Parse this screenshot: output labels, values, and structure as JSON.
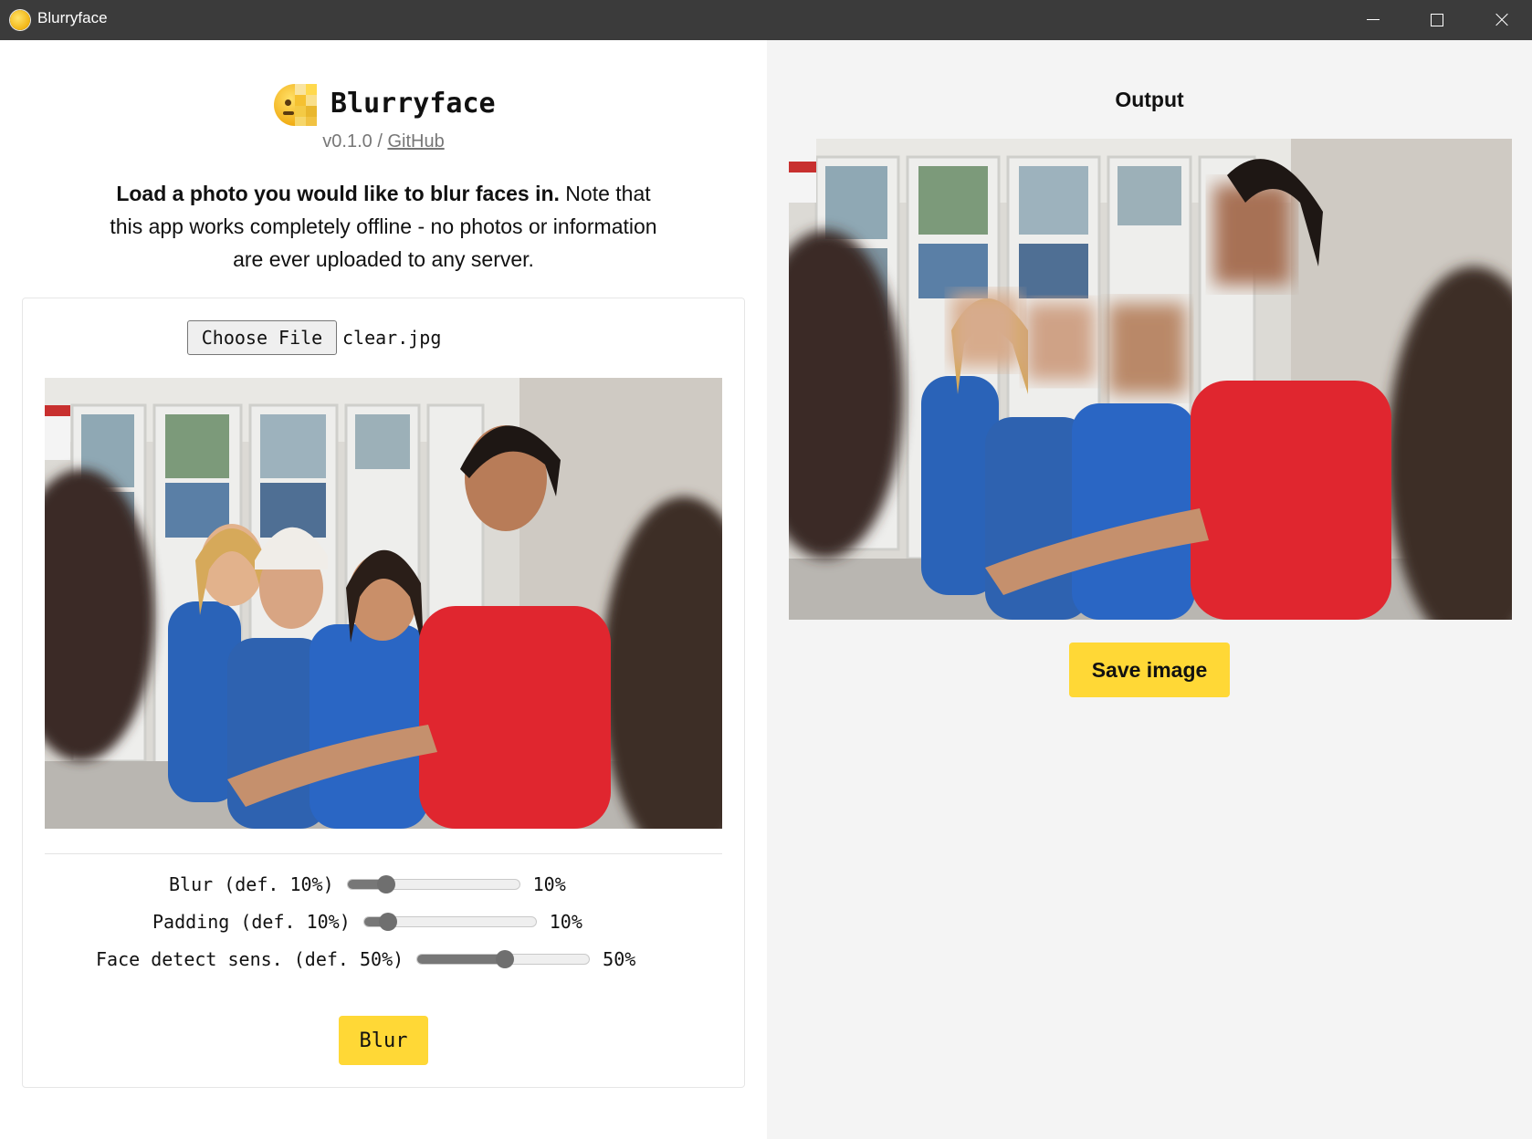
{
  "window": {
    "title": "Blurryface",
    "controls": [
      "minimize",
      "maximize",
      "close"
    ]
  },
  "header": {
    "app_name": "Blurryface",
    "version": "v0.1.0",
    "separator": " / ",
    "github_link": "GitHub"
  },
  "intro": {
    "bold": "Load a photo you would like to blur faces in.",
    "rest": " Note that this app works completely offline - no photos or information are ever uploaded to any server."
  },
  "file": {
    "button_label": "Choose File",
    "file_name": "clear.jpg"
  },
  "sliders": [
    {
      "label": "Blur (def. 10%)",
      "value_text": "10%",
      "value": 10
    },
    {
      "label": "Padding (def. 10%)",
      "value_text": "10%",
      "value": 10
    },
    {
      "label": "Face detect sens. (def. 50%)",
      "value_text": "50%",
      "value": 50
    }
  ],
  "actions": {
    "blur_label": "Blur",
    "save_label": "Save image"
  },
  "output": {
    "title": "Output"
  },
  "colors": {
    "accent_button": "#ffd836",
    "titlebar": "#3b3b3b",
    "output_bg": "#f4f4f4",
    "slider_fill": "#777777"
  },
  "icons": [
    "app-icon",
    "minimize-icon",
    "maximize-icon",
    "close-icon",
    "blurryface-logo-icon"
  ]
}
